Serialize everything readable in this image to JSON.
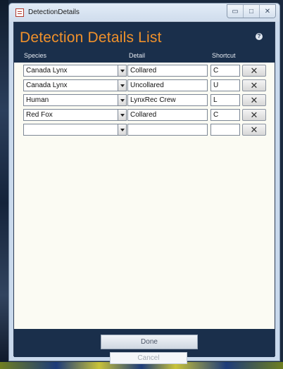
{
  "window": {
    "title": "DetectionDetails",
    "controls": [
      "▭",
      "□",
      "✕"
    ]
  },
  "header": {
    "title": "Detection Details List",
    "help_glyph": "?"
  },
  "columns": [
    "Species",
    "Detail",
    "Shortcut"
  ],
  "rows": [
    {
      "species": "Canada Lynx",
      "detail": "Collared",
      "shortcut": "C"
    },
    {
      "species": "Canada Lynx",
      "detail": "Uncollared",
      "shortcut": "U"
    },
    {
      "species": "Human",
      "detail": "LynxRec Crew",
      "shortcut": "L"
    },
    {
      "species": "Red Fox",
      "detail": "Collared",
      "shortcut": "C"
    },
    {
      "species": "",
      "detail": "",
      "shortcut": ""
    }
  ],
  "delete_glyph": "✕",
  "footer": {
    "done_label": "Done",
    "cancel_label": "Cancel"
  },
  "colors": {
    "header_bg": "#1a2f4b",
    "title_accent": "#f0912b",
    "form_bg": "#fbfbf3"
  }
}
